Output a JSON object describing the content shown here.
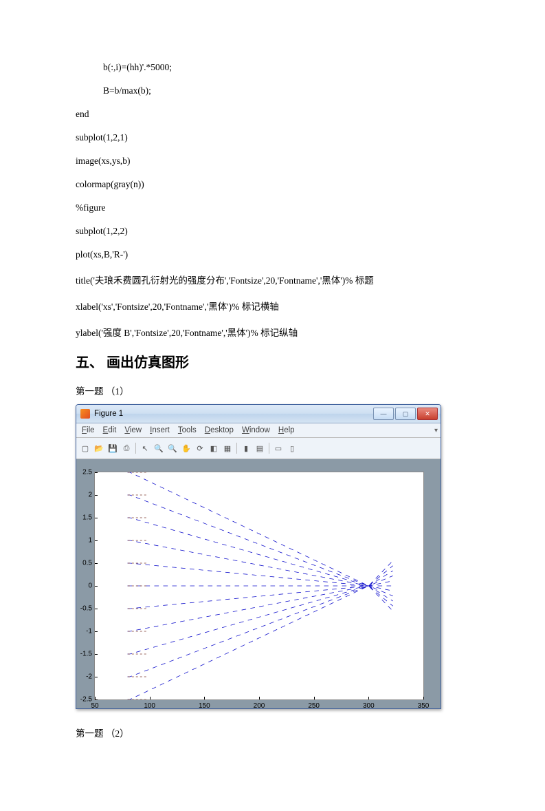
{
  "code": {
    "l1": "b(:,i)=(hh)'.*5000;",
    "l2": "B=b/max(b);",
    "l3": "end",
    "l4": "subplot(1,2,1)",
    "l5": "image(xs,ys,b)",
    "l6": "colormap(gray(n))",
    "l7": "%figure",
    "l8": "subplot(1,2,2)",
    "l9": "plot(xs,B,'R-')",
    "l10": "title('夫琅禾费圆孔衍射光的强度分布','Fontsize',20,'Fontname','黑体')%  标题",
    "l11": "xlabel('xs','Fontsize',20,'Fontname','黑体')%  标记横轴",
    "l12": "ylabel('强度 B','Fontsize',20,'Fontname','黑体')%  标记纵轴"
  },
  "heading": "五、 画出仿真图形",
  "caption_top": "第一题  （1）",
  "caption_bottom": "第一题  （2）",
  "figure": {
    "title": "Figure 1",
    "menu": {
      "file": "File",
      "edit": "Edit",
      "view": "View",
      "insert": "Insert",
      "tools": "Tools",
      "desktop": "Desktop",
      "window": "Window",
      "help": "Help"
    }
  },
  "chart_data": {
    "type": "line",
    "xlim": [
      50,
      350
    ],
    "ylim": [
      -2.5,
      2.5
    ],
    "xticks": [
      50,
      100,
      150,
      200,
      250,
      300,
      350
    ],
    "yticks": [
      2.5,
      2,
      1.5,
      1,
      0.5,
      0,
      -0.5,
      -1,
      -1.5,
      -2,
      -2.5
    ],
    "description": "Ray fan converging: multiple dashed blue ray lines starting near x≈80 at y values from -2.5 to 2.5 in 0.5 steps, converging to a crossover near x≈300, y≈0.",
    "crossover_x": 300,
    "crossover_y": 0,
    "ray_start_x": 80,
    "ray_start_ys": [
      -2.5,
      -2,
      -1.5,
      -1,
      -0.5,
      0,
      0.5,
      1,
      1.5,
      2,
      2.5
    ],
    "ray_color": "#1010cc",
    "line_style": "dashed"
  }
}
